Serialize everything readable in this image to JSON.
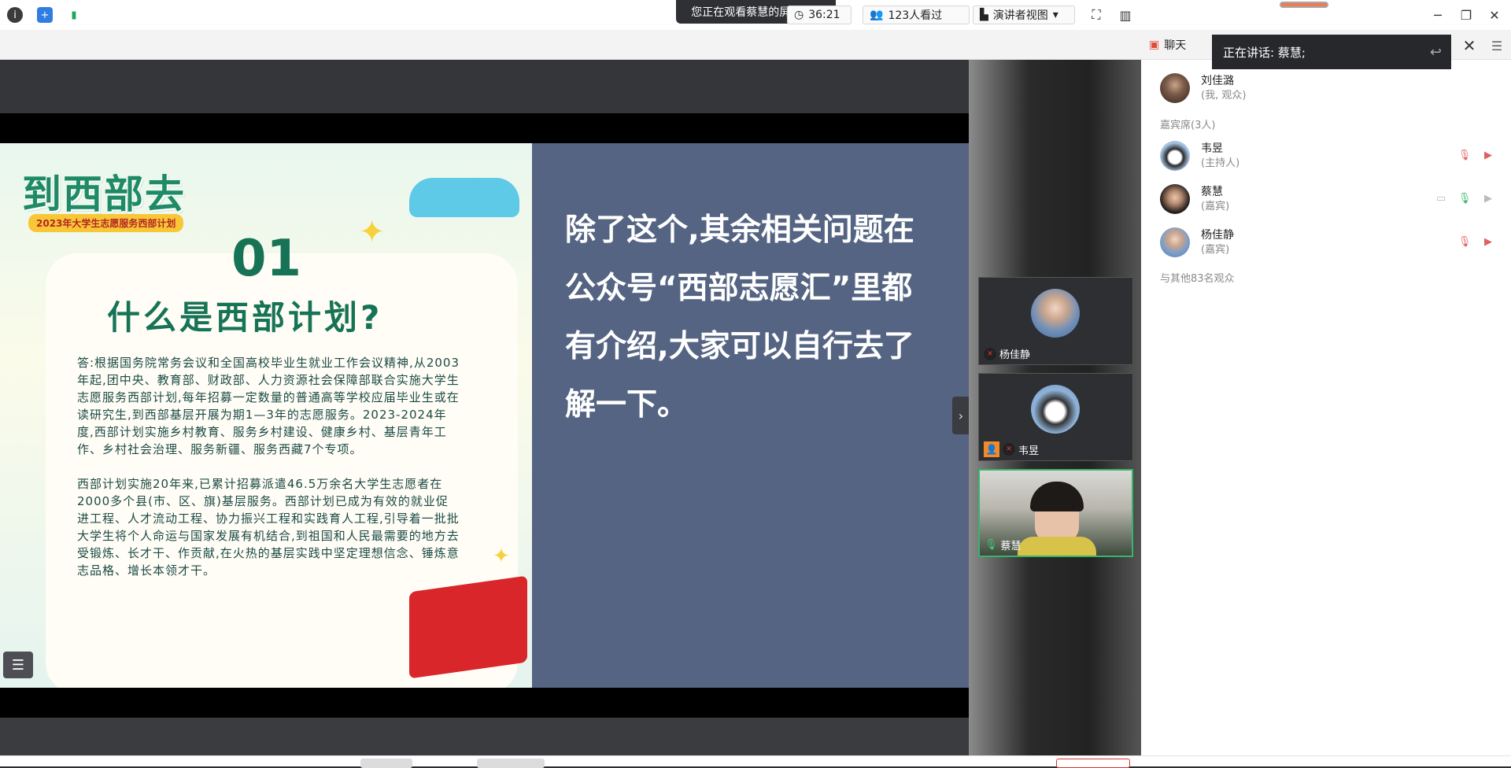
{
  "window": {
    "share_banner": "您正在观看蔡慧的屏幕",
    "share_menu_icon": "menu-lines-icon",
    "minimize": "─",
    "restore": "❐",
    "close": "✕"
  },
  "toolbar": {
    "timer": "36:21",
    "viewers": "123人看过",
    "view_mode": "演讲者视图",
    "view_mode_caret": "▾"
  },
  "panel": {
    "tab_label": "聊天",
    "speaking": "正在讲话: 蔡慧;",
    "me": {
      "name": "刘佳潞",
      "role": "(我, 观众)"
    },
    "guests_label": "嘉宾席(3人)",
    "guests": [
      {
        "name": "韦昱",
        "role": "(主持人)"
      },
      {
        "name": "蔡慧",
        "role": "(嘉宾)"
      },
      {
        "name": "杨佳静",
        "role": "(嘉宾)"
      }
    ],
    "others_label": "与其他83名观众"
  },
  "tiles": [
    {
      "name": "杨佳静"
    },
    {
      "name": "韦昱"
    },
    {
      "name": "蔡慧"
    }
  ],
  "slide": {
    "logo": "到西部去",
    "logo_sub": "2023年大学生志愿服务西部计划",
    "number": "01",
    "title": "什么是西部计划?",
    "paragraph1": "答:根据国务院常务会议和全国高校毕业生就业工作会议精神,从2003年起,团中央、教育部、财政部、人力资源社会保障部联合实施大学生志愿服务西部计划,每年招募一定数量的普通高等学校应届毕业生或在读研究生,到西部基层开展为期1—3年的志愿服务。2023-2024年度,西部计划实施乡村教育、服务乡村建设、健康乡村、基层青年工作、乡村社会治理、服务新疆、服务西藏7个专项。",
    "paragraph2": "西部计划实施20年来,已累计招募派遣46.5万余名大学生志愿者在2000多个县(市、区、旗)基层服务。西部计划已成为有效的就业促进工程、人才流动工程、协力振兴工程和实践育人工程,引导着一批批大学生将个人命运与国家发展有机结合,到祖国和人民最需要的地方去受锻炼、长才干、作贡献,在火热的基层实践中坚定理想信念、锤炼意志品格、增长本领才干。",
    "right_text": "除了这个,其余相关问题在公众号“西部志愿汇”里都有介绍,大家可以自行去了解一下。"
  },
  "colors": {
    "slide_green": "#177356",
    "slide_right_bg": "#546482",
    "active_border": "#37b56a"
  }
}
